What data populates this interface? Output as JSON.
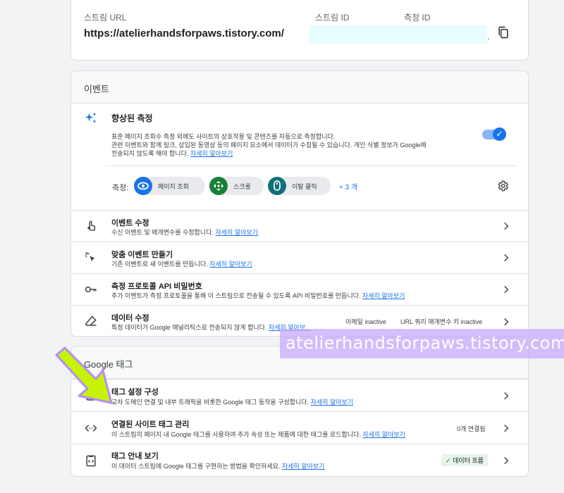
{
  "stream": {
    "url_label": "스트림 URL",
    "url_value": "https://atelierhandsforpaws.tistory.com/",
    "id_label": "스트림 ID",
    "measurement_label": "측정 ID",
    "trailing": "."
  },
  "events": {
    "title": "이벤트",
    "enhanced": {
      "title": "향상된 측정",
      "desc1": "표준 페이지 조회수 측정 외에도 사이트의 상호작용 및 콘텐츠를 자동으로 측정합니다.",
      "desc2": "관련 이벤트와 함께 링크, 삽입된 동영상 등의 페이지 요소에서 데이터가 수집될 수 있습니다. 개인 식별 정보가 Google에",
      "desc3": "전송되지 않도록 해야 합니다.",
      "learn_more": "자세히 알아보기",
      "toggle_on": true
    },
    "measuring_label": "측정:",
    "chips": [
      {
        "label": "페이지 조회",
        "color": "#1a73e8",
        "icon": "eye-icon"
      },
      {
        "label": "스크롤",
        "color": "#188038",
        "icon": "scroll-icon"
      },
      {
        "label": "이탈 클릭",
        "color": "#12707a",
        "icon": "mouse-icon"
      }
    ],
    "more": "+ 3 개",
    "rows": [
      {
        "title": "이벤트 수정",
        "desc": "수신 이벤트 및 매개변수를 수정합니다.",
        "link": "자세히 알아보기"
      },
      {
        "title": "맞춤 이벤트 만들기",
        "desc": "기존 이벤트로 새 이벤트를 만듭니다.",
        "link": "자세히 알아보기"
      },
      {
        "title": "측정 프로토콜 API 비밀번호",
        "desc": "추가 이벤트가 측정 프로토콜을 통해 이 스트림으로 전송될 수 있도록 API 비밀번호를 만듭니다.",
        "link": "자세히 알아보기"
      },
      {
        "title": "데이터 수정",
        "desc": "특정 데이터가 Google 애널리틱스로 전송되지 않게 합니다.",
        "link": "자세히 알아보...",
        "badge1": "이메일 inactive",
        "badge2": "URL 쿼리 매개변수 키 inactive"
      }
    ]
  },
  "tags": {
    "title": "Google 태그",
    "rows": [
      {
        "title": "태그 설정 구성",
        "desc": "교차 도메인 연결 및 내부 트래픽을 비롯한 Google 태그 동작을 구성합니다.",
        "link": "자세히 알아보기"
      },
      {
        "title": "연결된 사이트 태그 관리",
        "desc": "이 스트림의 페이지 내 Google 태그를 사용하여 추가 속성 또는 제품에 대한 태그를 로드합니다.",
        "link": "자세히 알아보기",
        "badge": "0개 연결됨"
      },
      {
        "title": "태그 안내 보기",
        "desc": "이 데이터 스트림에 Google 태그를 구현하는 방법을 확인하세요.",
        "link": "자세히 알아보기",
        "badge": "데이터 흐름"
      }
    ]
  },
  "watermark": "atelierhandsforpaws.tistory.com",
  "colors": {
    "accent": "#1a73e8",
    "arrow": "#c6f300",
    "watermark": "#c8aaff"
  }
}
